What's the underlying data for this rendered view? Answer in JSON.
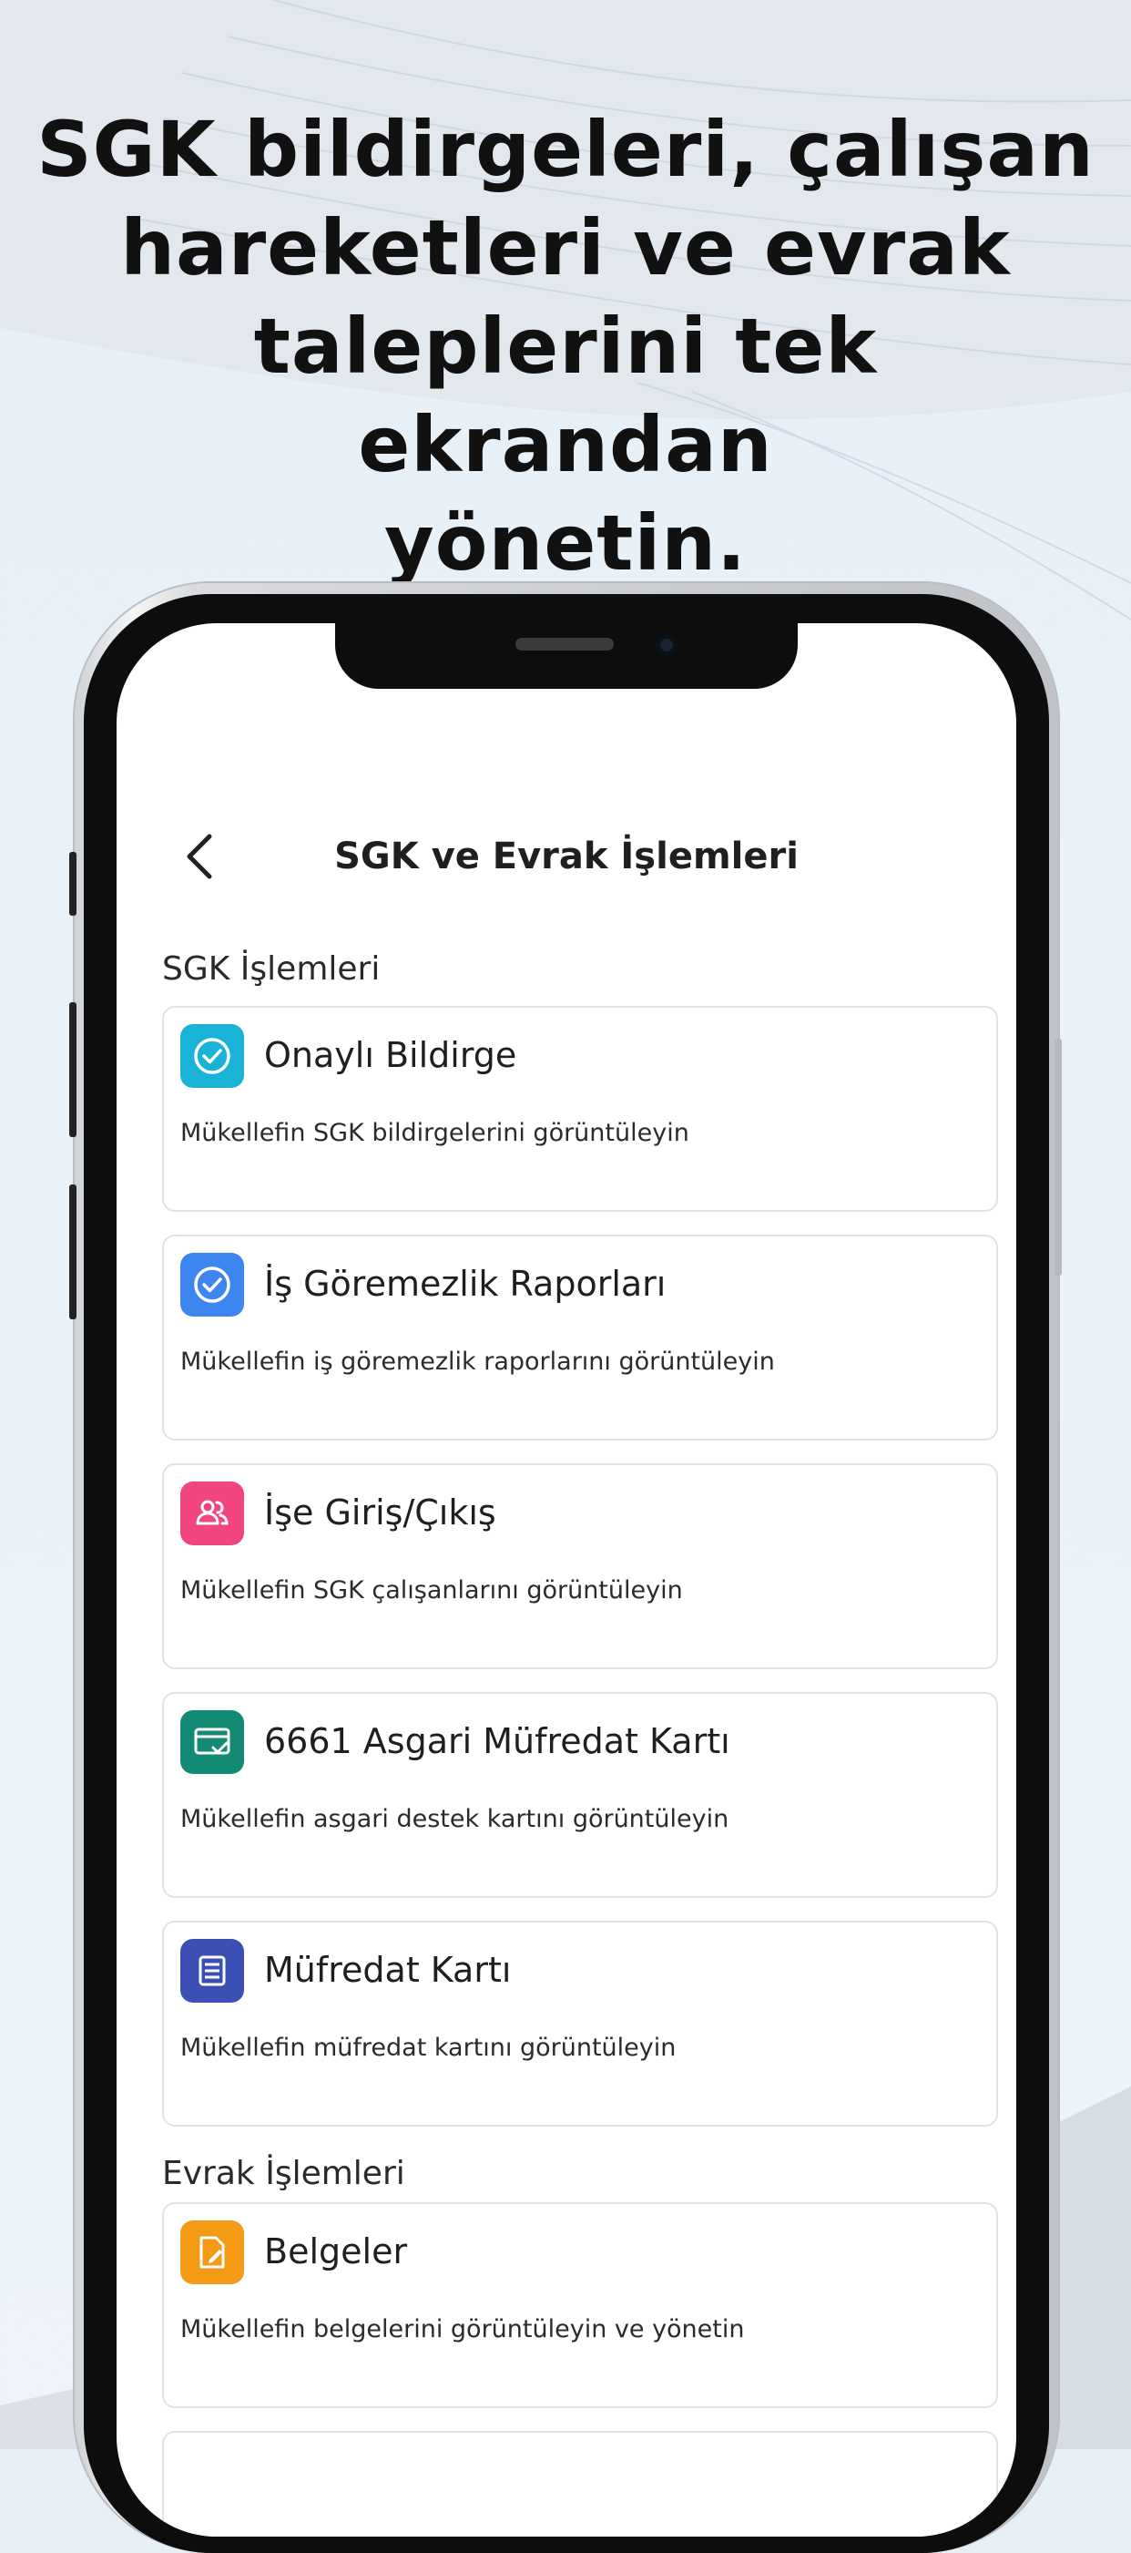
{
  "headline": {
    "line1": "SGK bildirgeleri, çalışan",
    "line2": "hareketleri ve evrak",
    "line3": "taleplerini tek ekrandan",
    "line4": "yönetin."
  },
  "app": {
    "title": "SGK ve Evrak İşlemleri",
    "back_icon": "chevron-left-icon",
    "sections": [
      {
        "title": "SGK İşlemleri",
        "items": [
          {
            "title": "Onaylı Bildirge",
            "description": "Mükellefin SGK bildirgelerini görüntüleyin",
            "icon": "check-circle-icon",
            "color": "#18b3d6"
          },
          {
            "title": "İş Göremezlik Raporları",
            "description": "Mükellefin iş göremezlik raporlarını görüntüleyin",
            "icon": "check-circle-icon",
            "color": "#3d86f0"
          },
          {
            "title": "İşe Giriş/Çıkış",
            "description": "Mükellefin SGK çalışanlarını görüntüleyin",
            "icon": "people-icon",
            "color": "#f0457e"
          },
          {
            "title": "6661 Asgari Müfredat Kartı",
            "description": "Mükellefin asgari destek kartını görüntüleyin",
            "icon": "card-check-icon",
            "color": "#138a73"
          },
          {
            "title": "Müfredat Kartı",
            "description": "Mükellefin müfredat kartını görüntüleyin",
            "icon": "list-box-icon",
            "color": "#3b4fb5"
          }
        ]
      },
      {
        "title": "Evrak İşlemleri",
        "items": [
          {
            "title": "Belgeler",
            "description": "Mükellefin belgelerini görüntüleyin ve yönetin",
            "icon": "document-edit-icon",
            "color": "#f59a14"
          }
        ]
      }
    ]
  }
}
